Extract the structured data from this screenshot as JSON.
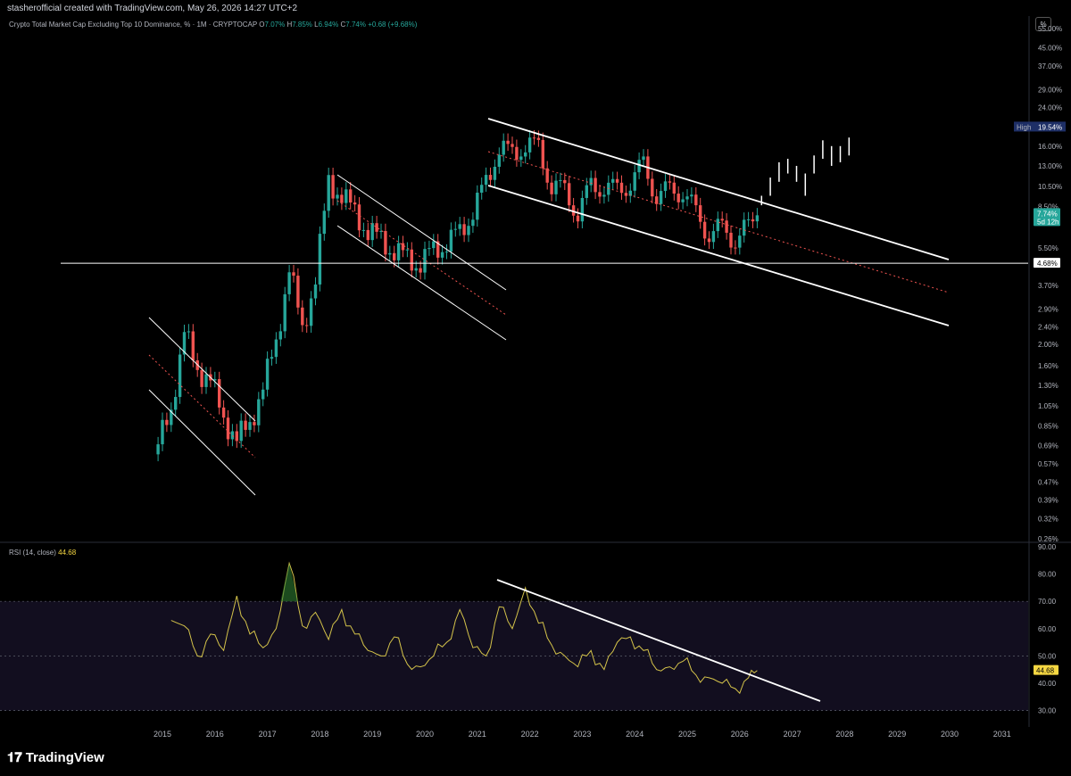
{
  "header": {
    "credit": "stasherofficial created with TradingView.com, May 26, 2026 14:27 UTC+2",
    "scale_button": "%"
  },
  "symbol": {
    "name": "Crypto Total Market Cap Excluding Top 10 Dominance, % · 1M · CRYPTOCAP",
    "o_label": "O",
    "o": "7.07%",
    "h_label": "H",
    "h": "7.85%",
    "l_label": "L",
    "l": "6.94%",
    "c_label": "C",
    "c": "7.74%",
    "change": "+0.68 (+9.68%)"
  },
  "rsi": {
    "label": "RSI (14, close)",
    "value": "44.68"
  },
  "branding": {
    "name": "TradingView",
    "mark": "𝟏𝟕"
  },
  "colors": {
    "up": "#26a69a",
    "down": "#ef5350",
    "rsi_line": "#d4c34a",
    "trend": "#ffffff",
    "median": "#ef5350",
    "rsi_band": "#120e1f"
  },
  "chart_data": [
    {
      "type": "candlestick",
      "title": "Crypto Total Market Cap Excluding Top 10 Dominance, % · 1M · CRYPTOCAP",
      "y_scale": "log",
      "y_ticks": [
        "55.00%",
        "45.00%",
        "37.00%",
        "29.00%",
        "24.00%",
        "16.00%",
        "13.00%",
        "10.50%",
        "8.50%",
        "5.50%",
        "3.70%",
        "2.90%",
        "2.40%",
        "2.00%",
        "1.60%",
        "1.30%",
        "1.05%",
        "0.85%",
        "0.69%",
        "0.57%",
        "0.47%",
        "0.39%",
        "0.32%",
        "0.26%"
      ],
      "x_ticks": [
        "2015",
        "2016",
        "2017",
        "2018",
        "2019",
        "2020",
        "2021",
        "2022",
        "2023",
        "2024",
        "2025",
        "2026",
        "2027",
        "2028",
        "2029",
        "2030",
        "2031"
      ],
      "price_labels": {
        "high_label": "High",
        "high_value": "19.54%",
        "current_value": "7.74%",
        "countdown": "5d 12h",
        "horizontal_level": "4.68%"
      },
      "horizontal_line": 4.68,
      "annotations": [
        "descending channel 2015-2016",
        "descending channel 2018-2020",
        "descending channel 2021-2026",
        "projected bars 2026-2028"
      ],
      "series": [
        {
          "name": "monthly closes (approx.)",
          "x": [
            "2014-12",
            "2015-03",
            "2015-06",
            "2015-09",
            "2015-12",
            "2016-03",
            "2016-06",
            "2016-09",
            "2016-12",
            "2017-03",
            "2017-06",
            "2017-09",
            "2017-12",
            "2018-03",
            "2018-06",
            "2018-09",
            "2018-12",
            "2019-03",
            "2019-06",
            "2019-09",
            "2019-12",
            "2020-03",
            "2020-06",
            "2020-09",
            "2020-12",
            "2021-03",
            "2021-06",
            "2021-09",
            "2021-12",
            "2022-03",
            "2022-06",
            "2022-09",
            "2022-12",
            "2023-03",
            "2023-06",
            "2023-09",
            "2023-12",
            "2024-03",
            "2024-06",
            "2024-09",
            "2024-12",
            "2025-03",
            "2025-06",
            "2025-09",
            "2025-12",
            "2026-03",
            "2026-05"
          ],
          "values": [
            0.7,
            1.0,
            2.3,
            1.5,
            1.4,
            0.9,
            0.75,
            0.85,
            1.3,
            2.0,
            4.5,
            2.3,
            4.0,
            11.0,
            9.5,
            8.0,
            6.5,
            6.0,
            5.3,
            4.9,
            4.7,
            5.3,
            5.9,
            6.3,
            8.3,
            10.5,
            16.5,
            14.0,
            17.0,
            15.0,
            11.0,
            9.5,
            8.3,
            10.0,
            11.0,
            9.5,
            11.5,
            12.5,
            10.0,
            9.5,
            10.5,
            7.5,
            6.7,
            6.4,
            6.3,
            6.5,
            7.74
          ]
        }
      ]
    },
    {
      "type": "line",
      "title": "RSI (14, close)",
      "y_ticks": [
        "90.00",
        "80.00",
        "70.00",
        "60.00",
        "50.00",
        "40.00",
        "30.00"
      ],
      "ylim": [
        30,
        90
      ],
      "bands": [
        30,
        50,
        70
      ],
      "current_value": "44.68",
      "series": [
        {
          "name": "RSI (14, close)",
          "x": [
            "2015-03",
            "2015-06",
            "2015-09",
            "2015-12",
            "2016-03",
            "2016-06",
            "2016-09",
            "2016-12",
            "2017-03",
            "2017-06",
            "2017-09",
            "2017-12",
            "2018-03",
            "2018-06",
            "2018-09",
            "2018-12",
            "2019-03",
            "2019-06",
            "2019-09",
            "2019-12",
            "2020-03",
            "2020-06",
            "2020-09",
            "2020-12",
            "2021-03",
            "2021-06",
            "2021-09",
            "2021-12",
            "2022-03",
            "2022-06",
            "2022-09",
            "2022-12",
            "2023-03",
            "2023-06",
            "2023-09",
            "2023-12",
            "2024-03",
            "2024-06",
            "2024-09",
            "2024-12",
            "2025-03",
            "2025-06",
            "2025-09",
            "2025-12",
            "2026-03",
            "2026-05"
          ],
          "values": [
            63,
            61,
            50,
            58,
            52,
            72,
            58,
            53,
            60,
            84,
            61,
            66,
            56,
            67,
            58,
            52,
            50,
            57,
            47,
            46,
            50,
            55,
            67,
            53,
            50,
            68,
            60,
            75,
            62,
            54,
            50,
            46,
            52,
            45,
            55,
            57,
            52,
            45,
            46,
            48,
            43,
            42,
            40,
            38,
            42,
            44.68
          ]
        }
      ]
    }
  ]
}
